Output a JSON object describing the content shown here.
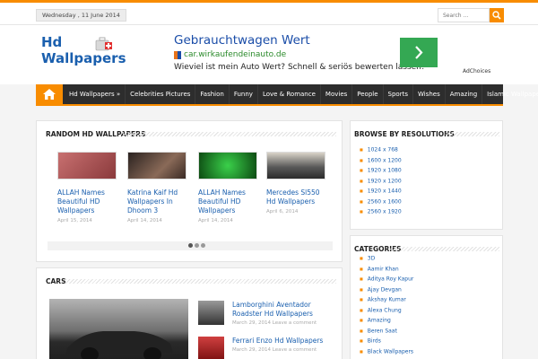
{
  "topbar": {
    "date": "Wednesday , 11 June 2014",
    "search_placeholder": "Search ...",
    "search_icon": "search-icon"
  },
  "logo": {
    "line1": "Hd",
    "line2": "Wallpapers"
  },
  "ad": {
    "title": "Gebrauchtwagen Wert",
    "url": "car.wirkaufendeinauto.de",
    "description": "Wieviel ist mein Auto Wert? Schnell & seriös bewerten lassen!",
    "choices": "AdChoices"
  },
  "nav": {
    "home_icon": "home-icon",
    "items": [
      "Hd Wallpapers »",
      "Celebrities Pictures",
      "Fashion",
      "Funny",
      "Love & Romance",
      "Movies",
      "People",
      "Sports",
      "Wishes",
      "Amazing",
      "Islamic Wallpapers"
    ]
  },
  "random": {
    "title": "Random HD Wallpapers",
    "slides": [
      {
        "title": "ALLAH Names Beautiful HD Wallpapers",
        "date": "April 15, 2014",
        "color": "#b5585a"
      },
      {
        "title": "Katrina Kaif Hd Wallpapers In Dhoom 3",
        "date": "April 14, 2014",
        "color": "#6b4a3e"
      },
      {
        "title": "ALLAH Names Beautiful HD Wallpapers",
        "date": "April 14, 2014",
        "color": "#1d8a2a"
      },
      {
        "title": "Mercedes Sl550 Hd Wallpapers",
        "date": "April 6, 2014",
        "color": "#3a3a3a"
      }
    ],
    "dots": 3,
    "active_dot": 0
  },
  "cars": {
    "title": "Cars",
    "items": [
      {
        "title": "Lamborghini Aventador Roadster Hd Wallpapers",
        "date": "March 29, 2014",
        "comment": "Leave a comment",
        "color": "#6a6a6a"
      },
      {
        "title": "Ferrari Enzo Hd Wallpapers",
        "date": "March 29, 2014",
        "comment": "Leave a comment",
        "color": "#b02020"
      }
    ]
  },
  "resolutions": {
    "title": "Browse By Resolutions",
    "items": [
      "1024 x 768",
      "1600 x 1200",
      "1920 x 1080",
      "1920 x 1200",
      "1920 x 1440",
      "2560 x 1600",
      "2560 x 1920"
    ]
  },
  "categories": {
    "title": "Categories",
    "items": [
      "3D",
      "Aamir Khan",
      "Aditya Roy Kapur",
      "Ajay Devgan",
      "Akshay Kumar",
      "Alexa Chung",
      "Amazing",
      "Beren Saat",
      "Birds",
      "Black Wallpapers"
    ]
  },
  "colors": {
    "accent": "#f88c00",
    "nav_bg": "#2d2d2d",
    "link": "#1a5fae"
  }
}
